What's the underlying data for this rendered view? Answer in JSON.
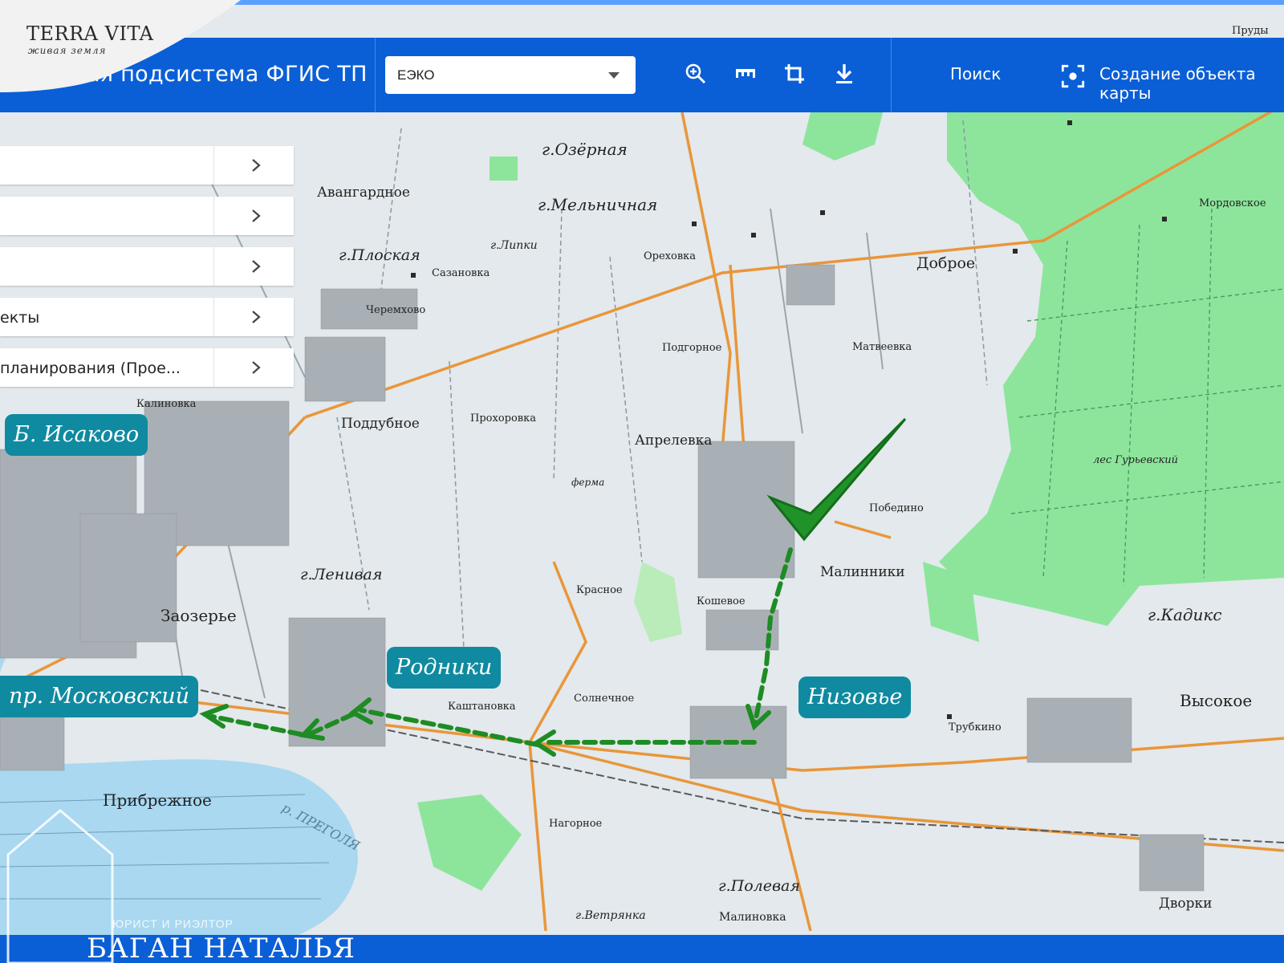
{
  "header": {
    "title": "ная подсистема ФГИС ТП",
    "layer_select": {
      "value": "ЕЭКО"
    },
    "tools": [
      "zoom-in-icon",
      "ruler-icon",
      "crop-icon",
      "download-icon"
    ],
    "search_label": "Поиск",
    "create_label": "Создание объекта карты"
  },
  "logo": {
    "name": "TERRA VITA",
    "tagline": "живая земля"
  },
  "menu": {
    "items": [
      {
        "label": ""
      },
      {
        "label": ""
      },
      {
        "label": ""
      },
      {
        "label": "екты"
      },
      {
        "label": "планирования (Прое..."
      }
    ]
  },
  "callouts": {
    "isakovo": "Б. Исаково",
    "moskovsky": "пр. Московский",
    "rodniki": "Родники",
    "nizovye": "Низовье"
  },
  "map_labels": {
    "ozernaya": "г.Озёрная",
    "melnichnaya": "г.Мельничная",
    "avangardnoe": "Авангардное",
    "ploskaya": "г.Плоская",
    "sazanovka": "Сазановка",
    "cheremkhovo": "Черемхово",
    "lipki": "г.Липки",
    "orekhovka": "Ореховка",
    "podgornoe": "Подгорное",
    "dobroe": "Доброе",
    "matveevka": "Матвеевка",
    "kalinovka": "Калиновка",
    "poddubnoe": "Поддубное",
    "prokhorovka": "Прохоровка",
    "aprelevka": "Апрелевка",
    "pobedino": "Победино",
    "malinniki": "Малинники",
    "lenivaya": "г.Ленивая",
    "zaozerye": "Заозерье",
    "krasnoe": "Красное",
    "koshevoe": "Кошевое",
    "kadiks": "г.Кадикс",
    "solnechnoe": "Солнечное",
    "kashtanovka": "Каштановка",
    "trubkino": "Трубкино",
    "vysokoe": "Высокое",
    "pribrezhnoe": "Прибрежное",
    "nagornoe": "Нагорное",
    "polevaya": "г.Полевая",
    "vetryanka": "г.Ветрянка",
    "malinovka": "Малиновка",
    "dvorki": "Дворки",
    "pregolya": "р. ПРЕГОЛЯ",
    "les_guryevsky": "лес Гурьевский",
    "mordovskoe": "Мордовское",
    "prudy": "Пруды",
    "ferma": "ферма"
  },
  "watermark": {
    "role": "ЮРИСТ И РИЭЛТОР",
    "name": "БАГАН НАТАЛЬЯ"
  },
  "colors": {
    "header": "#0a5fd6",
    "callout": "#0f8aa0",
    "route": "#1e8c24",
    "forest": "#88e89a",
    "road": "#e9963a"
  }
}
